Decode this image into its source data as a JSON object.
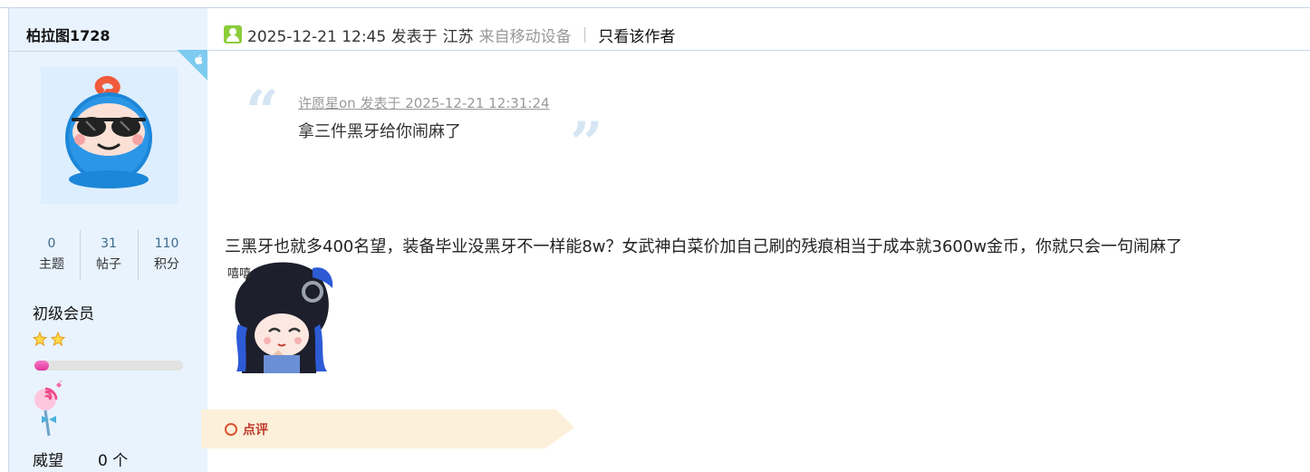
{
  "author": {
    "username": "柏拉图1728",
    "stats": [
      {
        "value": "0",
        "label": "主题"
      },
      {
        "value": "31",
        "label": "帖子"
      },
      {
        "value": "110",
        "label": "积分"
      }
    ],
    "rank": "初级会员",
    "level_progress": 0.1,
    "prestige_label": "威望",
    "prestige_value": "0 个"
  },
  "post": {
    "time": "2025-12-21 12:45 发表于",
    "location": "江苏",
    "device": "来自移动设备",
    "separator": "|",
    "only_author": "只看该作者",
    "quote": {
      "meta": "许愿星on 发表于 2025-12-21 12:31:24",
      "text": "拿三件黑牙给你闹麻了"
    },
    "body": "三黑牙也就多400名望，装备毕业没黑牙不一样能8w？女武神白菜价加自己刷的残痕相当于成本就3600w金币，你就只会一句闹麻了",
    "sticker_caption": "嘻嘻"
  },
  "comment": {
    "label": "点评"
  },
  "icons": {
    "author_icon": "user-icon",
    "platform": "apple-icon",
    "comment": "circle-icon"
  },
  "colors": {
    "sidebar_bg": "#e8f3fe",
    "accent_blue": "#7ecbf0",
    "level_fill": "#e2379c",
    "comment_red": "#c0392b"
  }
}
